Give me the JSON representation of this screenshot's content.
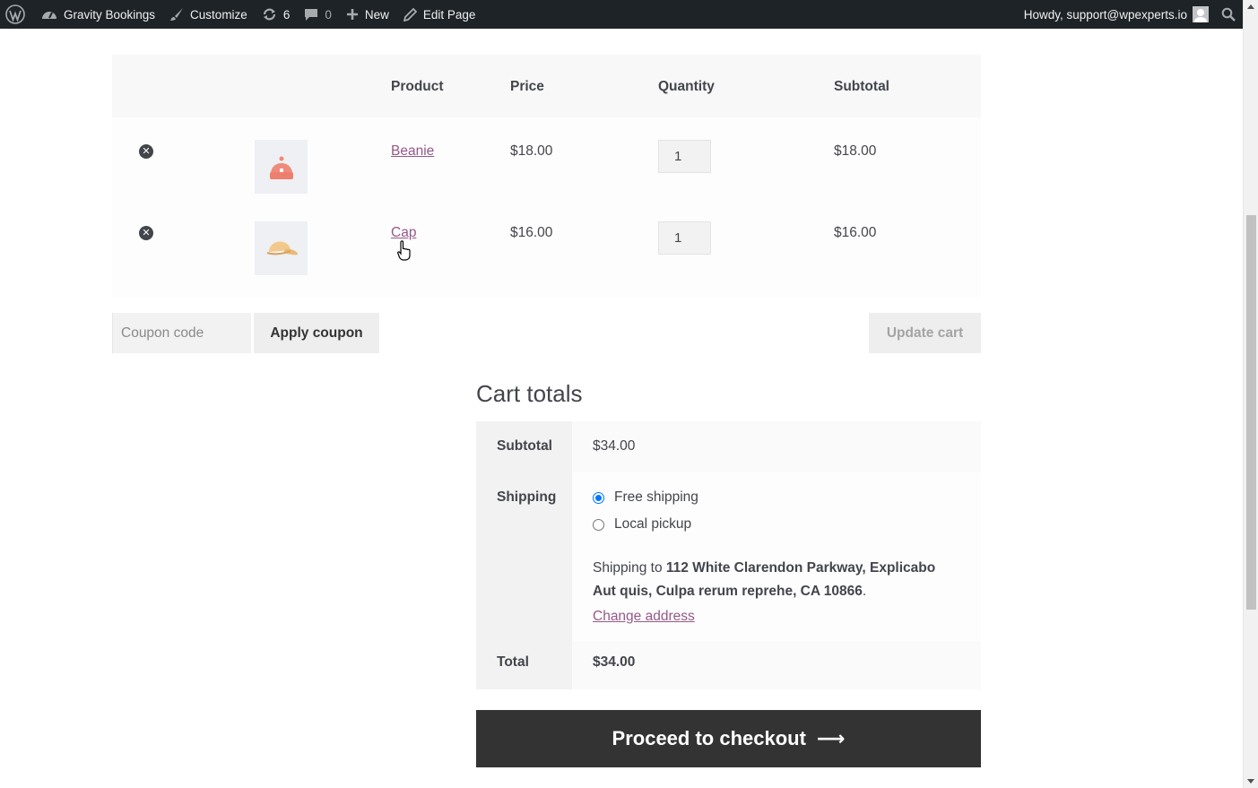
{
  "adminbar": {
    "site_name": "Gravity Bookings",
    "customize": "Customize",
    "updates_count": "6",
    "comments_count": "0",
    "new_label": "New",
    "edit_page": "Edit Page",
    "howdy": "Howdy, support@wpexperts.io"
  },
  "cart": {
    "headers": {
      "product": "Product",
      "price": "Price",
      "quantity": "Quantity",
      "subtotal": "Subtotal"
    },
    "items": [
      {
        "name": "Beanie",
        "price": "$18.00",
        "qty": "1",
        "subtotal": "$18.00"
      },
      {
        "name": "Cap",
        "price": "$16.00",
        "qty": "1",
        "subtotal": "$16.00"
      }
    ],
    "coupon_placeholder": "Coupon code",
    "apply_coupon": "Apply coupon",
    "update_cart": "Update cart"
  },
  "totals": {
    "title": "Cart totals",
    "subtotal_label": "Subtotal",
    "subtotal_value": "$34.00",
    "shipping_label": "Shipping",
    "shipping_options": [
      "Free shipping",
      "Local pickup"
    ],
    "shipping_to_prefix": "Shipping to",
    "shipping_address": "112 White Clarendon Parkway, Explicabo Aut quis, Culpa rerum reprehe, CA 10866",
    "change_address": "Change address",
    "total_label": "Total",
    "total_value": "$34.00",
    "checkout": "Proceed to checkout",
    "checkout_arrow": "⟶"
  }
}
